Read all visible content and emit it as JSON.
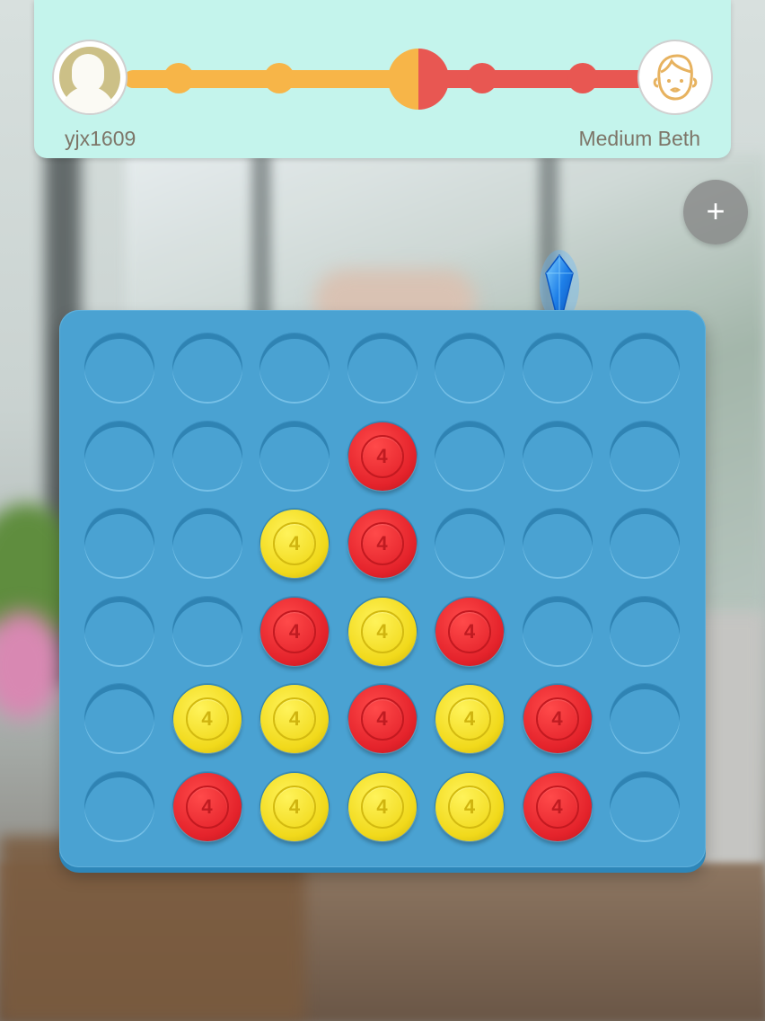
{
  "header": {
    "player_left": {
      "name": "yjx1609",
      "avatar": "default-user-avatar-icon",
      "color": "#f7b548"
    },
    "player_right": {
      "name": "Medium Beth",
      "avatar": "child-face-avatar-icon",
      "color": "#e85752"
    },
    "progress_balance": 0.5
  },
  "controls": {
    "plus_icon": "plus-icon",
    "plus_symbol": "+"
  },
  "board": {
    "columns": 7,
    "rows": 6,
    "board_color": "#4aa2d2",
    "drop_marker": {
      "icon": "blue-gem-icon",
      "column": 5
    },
    "disc_symbol": "4",
    "colors": {
      "red": "#e4232b",
      "yellow": "#f1d91b"
    },
    "cells": [
      [
        "",
        "",
        "",
        "",
        "",
        "",
        ""
      ],
      [
        "",
        "",
        "",
        "red",
        "",
        "",
        ""
      ],
      [
        "",
        "",
        "yellow",
        "red",
        "",
        "",
        ""
      ],
      [
        "",
        "",
        "red",
        "yellow",
        "red",
        "",
        ""
      ],
      [
        "",
        "yellow",
        "yellow",
        "red",
        "yellow",
        "red",
        ""
      ],
      [
        "",
        "red",
        "yellow",
        "yellow",
        "yellow",
        "red",
        ""
      ]
    ]
  }
}
